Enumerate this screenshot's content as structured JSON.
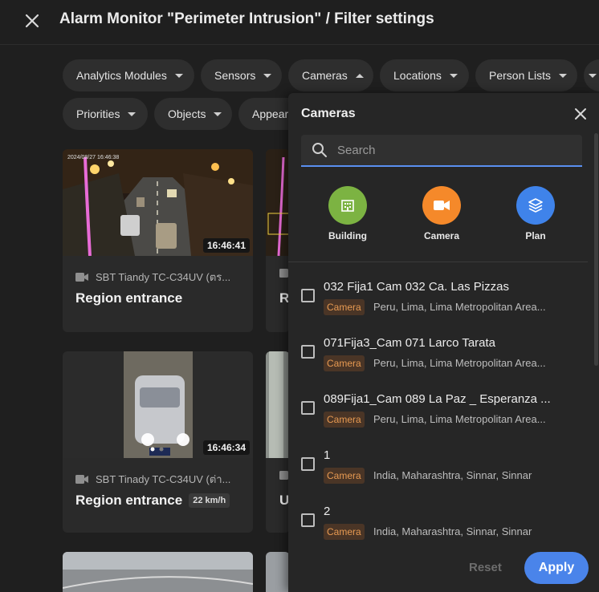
{
  "header": {
    "title": "Alarm Monitor \"Perimeter Intrusion\" / Filter settings"
  },
  "filters": {
    "row1": [
      "Analytics Modules",
      "Sensors",
      "Cameras",
      "Locations",
      "Person Lists"
    ],
    "row2": [
      "Priorities",
      "Objects",
      "Appear"
    ]
  },
  "cards": [
    {
      "time": "16:46:41",
      "camera": "SBT Tiandy TC-C34UV (ตร...",
      "event": "Region entrance"
    },
    {
      "time": "16:46:34",
      "camera": "SBT Tinady TC-C34UV (ต่า...",
      "event": "Region entrance",
      "speed": "22 km/h"
    }
  ],
  "partial_cards": [
    "R",
    "U"
  ],
  "panel": {
    "title": "Cameras",
    "search_placeholder": "Search",
    "types": [
      {
        "label": "Building",
        "icon": "building-icon",
        "color": "#7cb342"
      },
      {
        "label": "Camera",
        "icon": "camera-icon",
        "color": "#f5892a"
      },
      {
        "label": "Plan",
        "icon": "layers-icon",
        "color": "#3f83ea"
      }
    ],
    "items": [
      {
        "name": "032 Fija1 Cam 032 Ca. Las Pizzas",
        "badge": "Camera",
        "location": "Peru, Lima, Lima Metropolitan Area..."
      },
      {
        "name": "071Fija3_Cam 071 Larco Tarata",
        "badge": "Camera",
        "location": "Peru, Lima, Lima Metropolitan Area..."
      },
      {
        "name": "089Fija1_Cam 089 La Paz _ Esperanza ...",
        "badge": "Camera",
        "location": "Peru, Lima, Lima Metropolitan Area..."
      },
      {
        "name": "1",
        "badge": "Camera",
        "location": "India, Maharashtra, Sinnar, Sinnar"
      },
      {
        "name": "2",
        "badge": "Camera",
        "location": "India, Maharashtra, Sinnar, Sinnar"
      }
    ],
    "reset_label": "Reset",
    "apply_label": "Apply"
  }
}
